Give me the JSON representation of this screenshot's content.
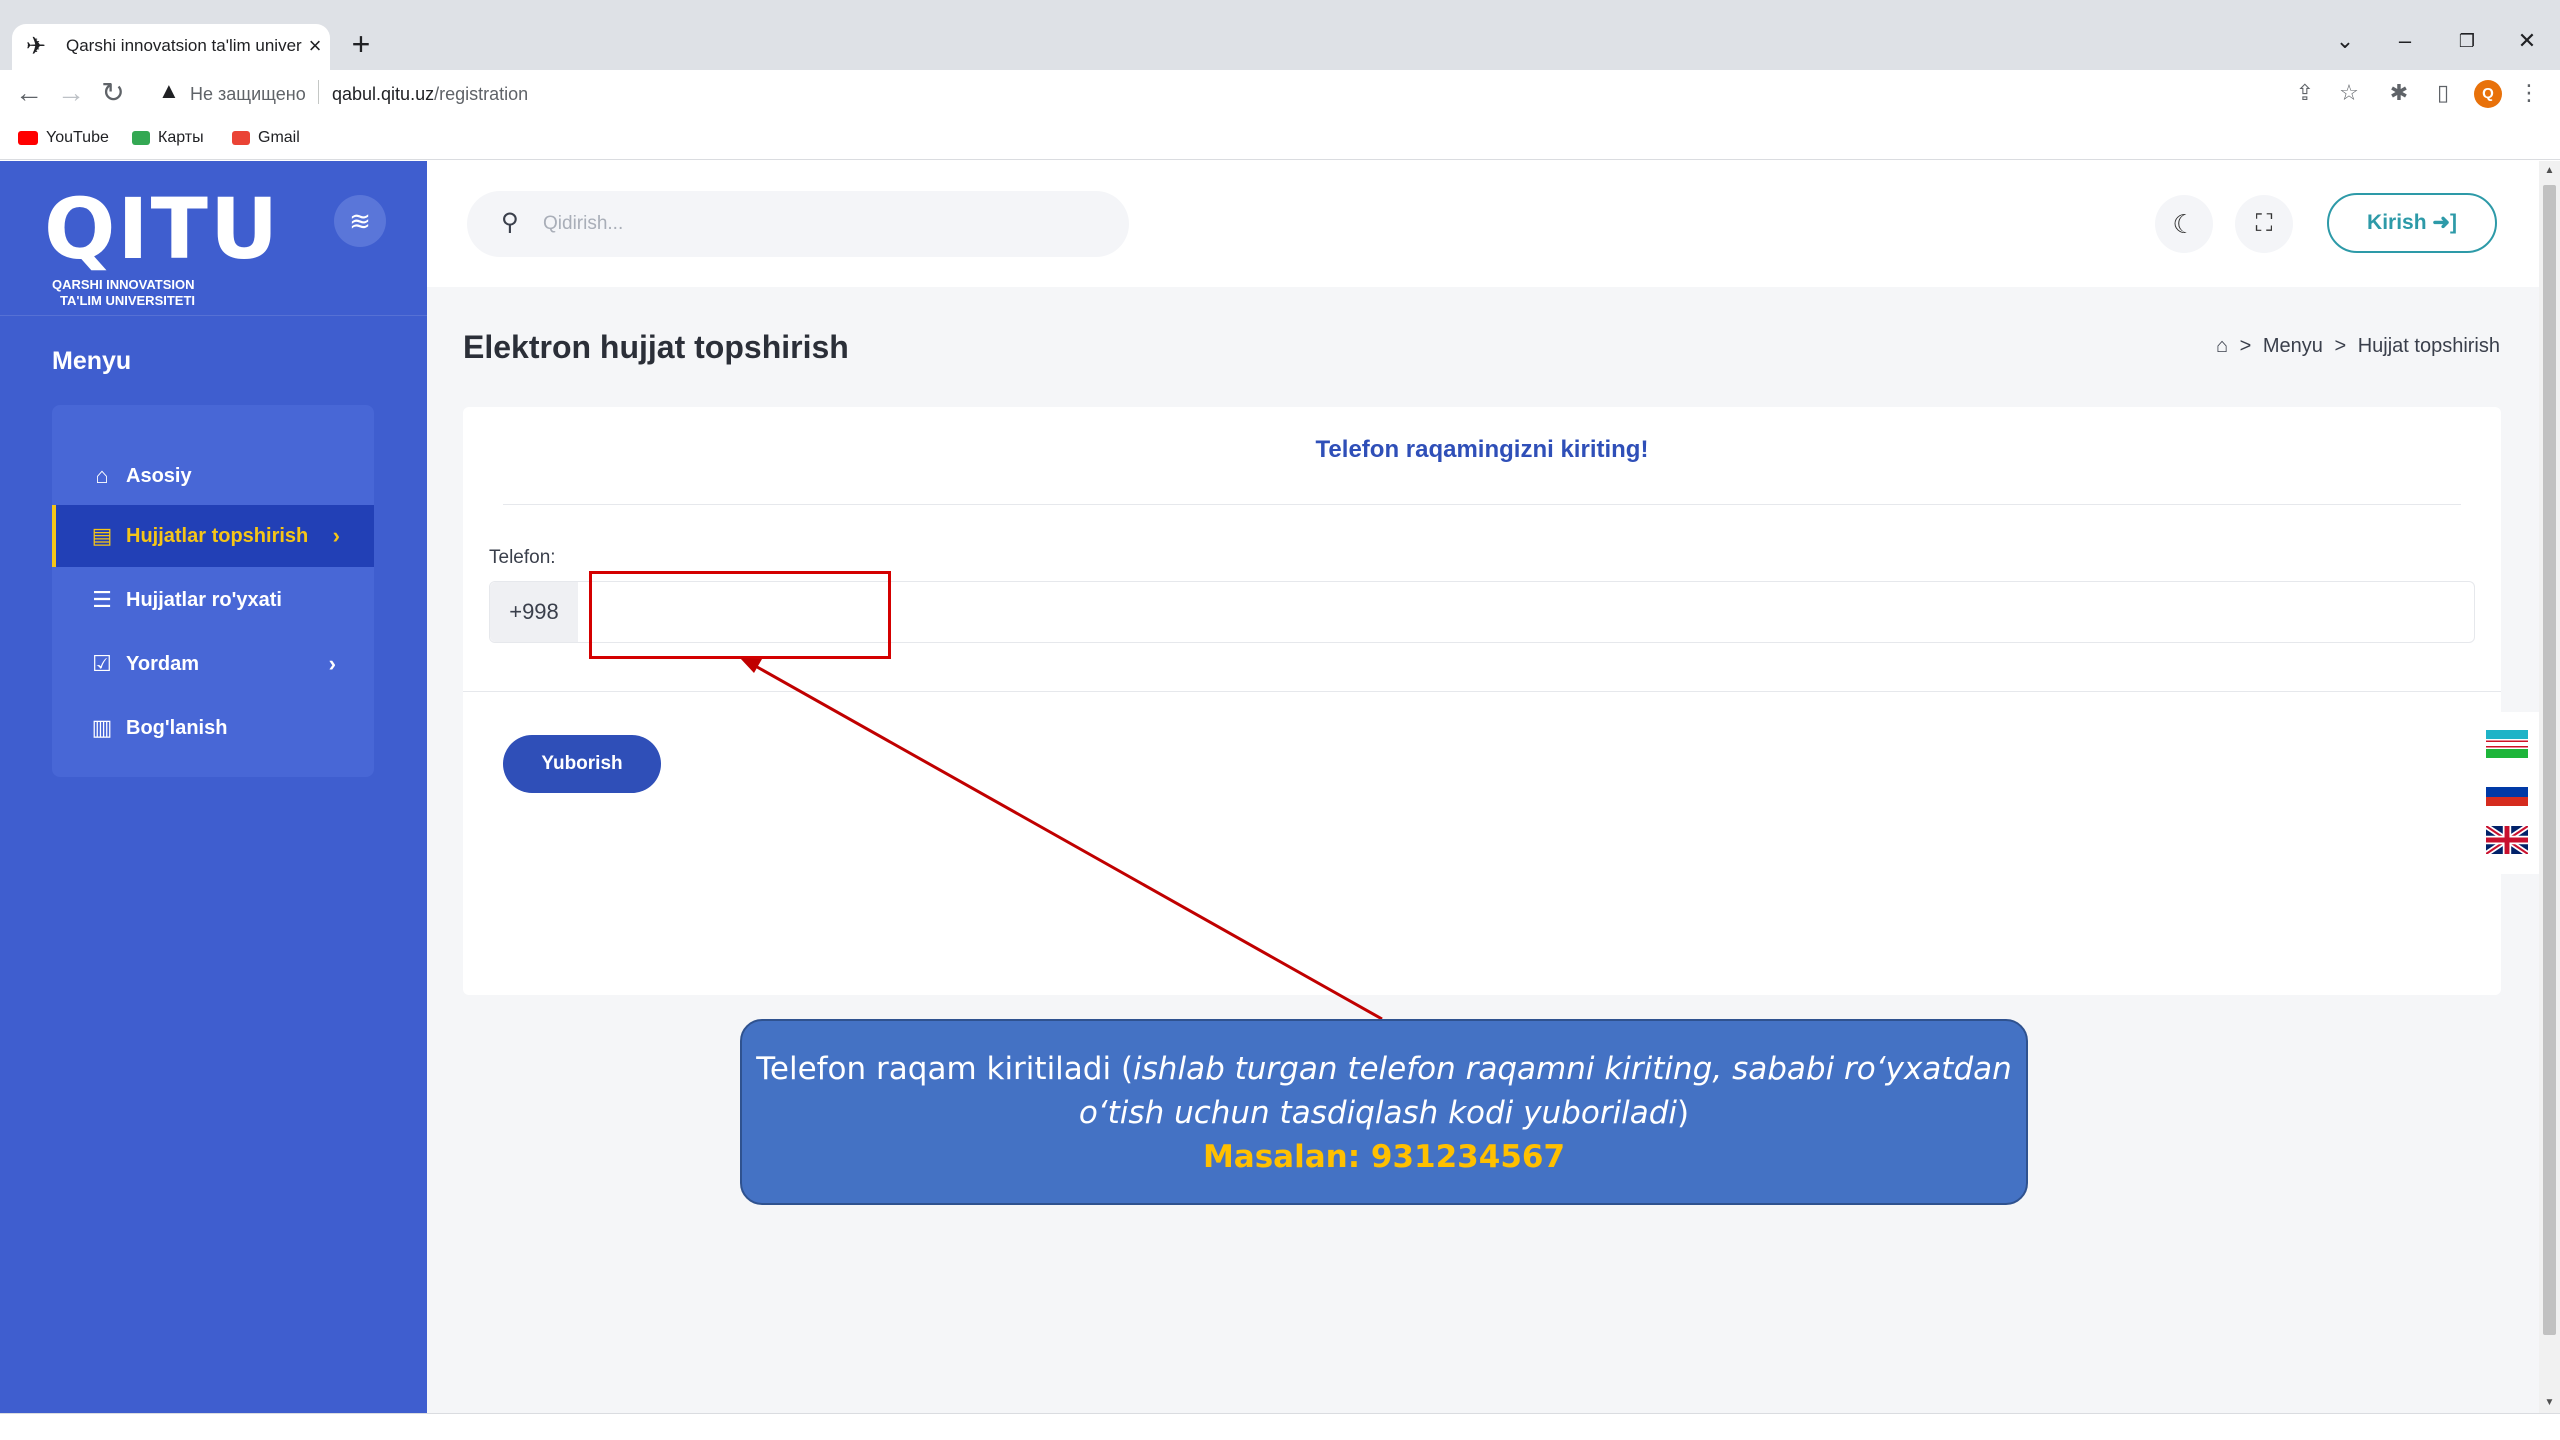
{
  "browser": {
    "tab_title": "Qarshi innovatsion ta'lim univers",
    "tab_close": "×",
    "new_tab": "+",
    "insecure_label": "Не защищено",
    "url_host": "qabul.qitu.uz",
    "url_path": "/registration",
    "profile_initial": "Q",
    "bookmarks": [
      {
        "label": "YouTube",
        "color": "#ff0000"
      },
      {
        "label": "Карты",
        "color": "#34a853"
      },
      {
        "label": "Gmail",
        "color": "#ea4335"
      }
    ]
  },
  "sidebar": {
    "logo": "QITU",
    "logo_sub_line1": "QARSHI INNOVATSION",
    "logo_sub_line2": "TA'LIM UNIVERSITETI",
    "menu_heading": "Menyu",
    "items": [
      {
        "label": "Asosiy",
        "icon": "home-icon",
        "glyph": "⌂"
      },
      {
        "label": "Hujjatlar topshirish",
        "icon": "document-icon",
        "glyph": "▤",
        "chevron": "›",
        "active": true
      },
      {
        "label": "Hujjatlar ro'yxati",
        "icon": "list-icon",
        "glyph": "☰"
      },
      {
        "label": "Yordam",
        "icon": "checkbox-icon",
        "glyph": "☑",
        "chevron": "›"
      },
      {
        "label": "Bog'lanish",
        "icon": "map-icon",
        "glyph": "▥"
      }
    ],
    "accent_color": "#f5c518",
    "bg_color": "#3f5ecf"
  },
  "header": {
    "search_placeholder": "Qidirish...",
    "login_label": "Kirish ➜]"
  },
  "main": {
    "page_title": "Elektron hujjat topshirish",
    "breadcrumb": [
      "Menyu",
      "Hujjat topshirish"
    ],
    "breadcrumb_sep": ">",
    "card_title": "Telefon raqamingizni kiriting!",
    "phone_label": "Telefon:",
    "phone_prefix": "+998",
    "phone_value": "",
    "submit_label": "Yuborish"
  },
  "annotation": {
    "text_before": "Telefon raqam kiritiladi (",
    "text_italic": "ishlab turgan telefon raqamni kiriting, sababi ro‘yxatdan o‘tish uchun tasdiqlash kodi yuboriladi",
    "text_after": ")",
    "example": "Masalan: 931234567",
    "highlight_color": "#d40000",
    "callout_color": "#4472c4",
    "example_color": "#ffc000"
  },
  "languages": [
    "uz",
    "ru",
    "en"
  ]
}
